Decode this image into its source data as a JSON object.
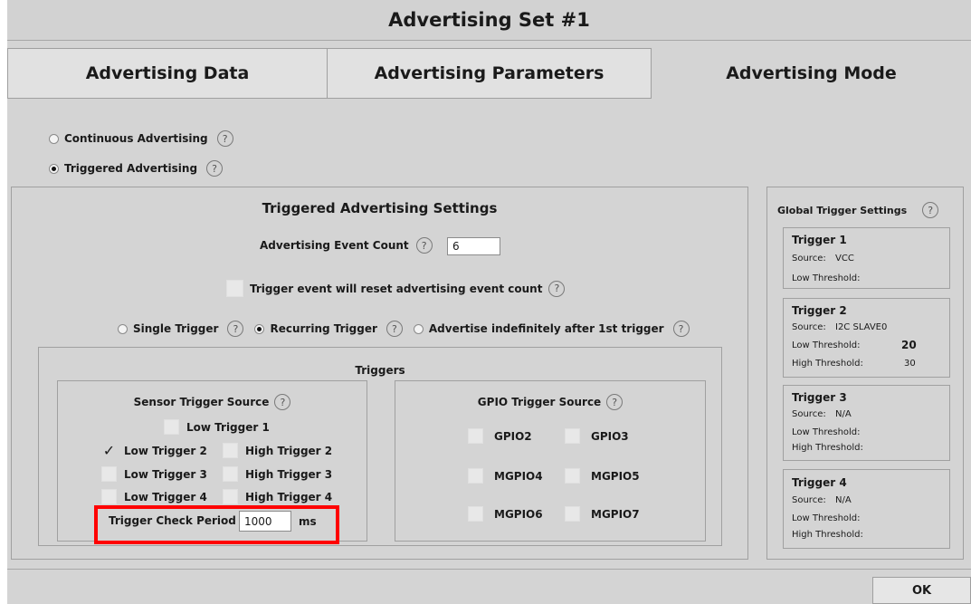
{
  "window": {
    "title": "Advertising Set #1"
  },
  "tabs": [
    {
      "label": "Advertising Data",
      "active": false
    },
    {
      "label": "Advertising Parameters",
      "active": false
    },
    {
      "label": "Advertising Mode",
      "active": true
    }
  ],
  "mode": {
    "continuous_label": "Continuous Advertising",
    "triggered_label": "Triggered Advertising",
    "selected": "triggered"
  },
  "help_glyph": "?",
  "triggered_settings": {
    "title": "Triggered Advertising Settings",
    "event_count_label": "Advertising Event Count",
    "event_count_value": "6",
    "reset_label": "Trigger event will reset advertising event count",
    "reset_checked": false,
    "single_label": "Single Trigger",
    "recurring_label": "Recurring Trigger",
    "indefinite_label": "Advertise indefinitely after 1st trigger",
    "selected_type": "recurring"
  },
  "triggers": {
    "title": "Triggers",
    "sensor": {
      "title": "Sensor Trigger Source",
      "low1": "Low Trigger 1",
      "low2": "Low Trigger 2",
      "high2": "High Trigger 2",
      "low3": "Low Trigger 3",
      "high3": "High Trigger 3",
      "low4": "Low Trigger 4",
      "high4": "High Trigger 4",
      "checked": [
        "low2"
      ],
      "check_mark": "✓",
      "period_label": "Trigger Check Period",
      "period_value": "1000",
      "period_unit": "ms"
    },
    "gpio": {
      "title": "GPIO Trigger Source",
      "gpio2": "GPIO2",
      "gpio3": "GPIO3",
      "mgpio4": "MGPIO4",
      "mgpio5": "MGPIO5",
      "mgpio6": "MGPIO6",
      "mgpio7": "MGPIO7"
    }
  },
  "global": {
    "title": "Global Trigger Settings",
    "source_label": "Source:",
    "low_label": "Low Threshold:",
    "high_label": "High Threshold:",
    "t1": {
      "name": "Trigger 1",
      "source": "VCC"
    },
    "t2": {
      "name": "Trigger 2",
      "source": "I2C SLAVE0",
      "low": "20",
      "high": "30"
    },
    "t3": {
      "name": "Trigger 3",
      "source": "N/A"
    },
    "t4": {
      "name": "Trigger 4",
      "source": "N/A"
    }
  },
  "buttons": {
    "ok": "OK"
  },
  "colors": {
    "highlight": "#ff0000",
    "window_bg": "#d4d4d4"
  }
}
